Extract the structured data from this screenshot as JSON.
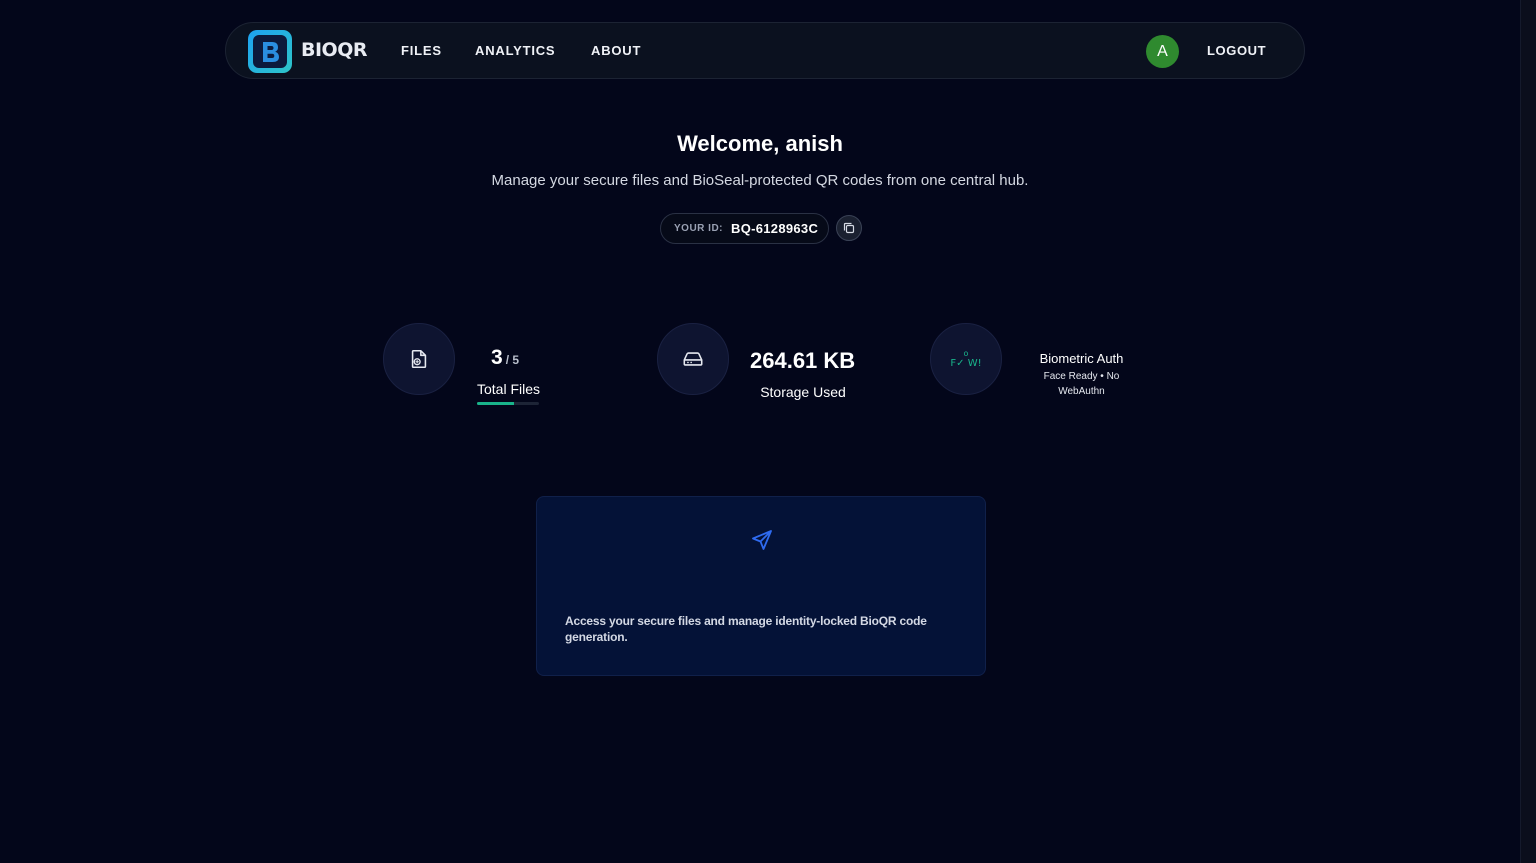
{
  "nav": {
    "brand": "BIOQR",
    "logo_letter": "B",
    "links": [
      "FILES",
      "ANALYTICS",
      "ABOUT"
    ],
    "avatar_initial": "A",
    "logout": "LOGOUT"
  },
  "hero": {
    "title": "Welcome, anish",
    "subtitle": "Manage your secure files and BioSeal-protected QR codes from one central hub.",
    "id_label": "YOUR ID:",
    "id_value": "BQ-6128963C"
  },
  "stats": {
    "files": {
      "count": "3",
      "max": "/ 5",
      "label": "Total Files",
      "progress_fraction": 0.6,
      "icon": "file-icon"
    },
    "storage": {
      "value": "264.61 KB",
      "label": "Storage Used",
      "icon": "hard-drive-icon"
    },
    "biometric": {
      "icon_dot": "o",
      "icon_text": "F✓ W!",
      "title": "Biometric Auth",
      "detail": "Face Ready • No WebAuthn"
    }
  },
  "card": {
    "icon": "send-icon",
    "text": "Access your secure files and manage identity-locked BioQR code generation."
  },
  "colors": {
    "background": "#03061a",
    "accent_green": "#19b38a",
    "avatar_green": "#2f8a2f",
    "card_blue": "#041237",
    "icon_blue": "#2f6bf0"
  }
}
